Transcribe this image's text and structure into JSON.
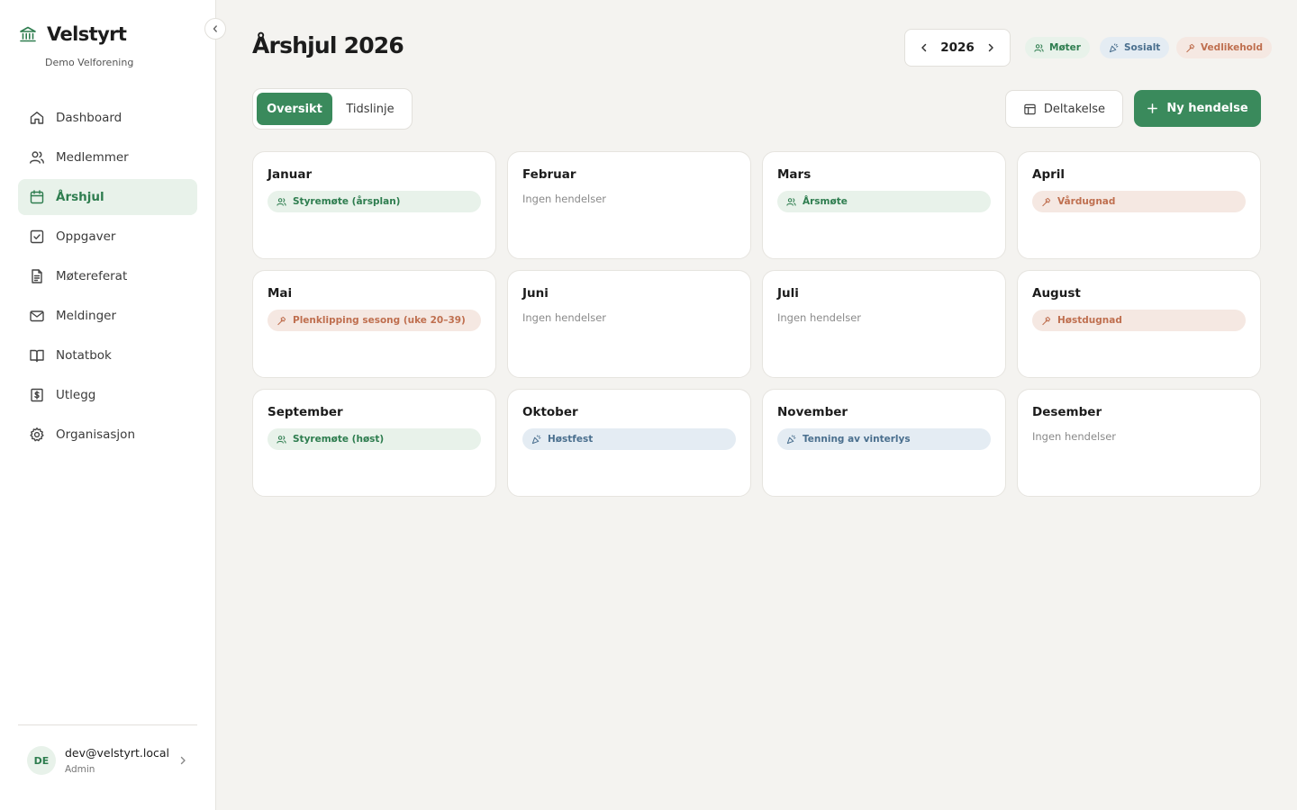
{
  "brand": {
    "name": "Velstyrt",
    "org": "Demo Velforening"
  },
  "nav": [
    {
      "label": "Dashboard",
      "icon": "home-icon",
      "active": false
    },
    {
      "label": "Medlemmer",
      "icon": "users-icon",
      "active": false
    },
    {
      "label": "Årshjul",
      "icon": "calendar-icon",
      "active": true
    },
    {
      "label": "Oppgaver",
      "icon": "checkbox-icon",
      "active": false
    },
    {
      "label": "Møtereferat",
      "icon": "document-icon",
      "active": false
    },
    {
      "label": "Meldinger",
      "icon": "mail-icon",
      "active": false
    },
    {
      "label": "Notatbok",
      "icon": "book-icon",
      "active": false
    },
    {
      "label": "Utlegg",
      "icon": "receipt-dollar-icon",
      "active": false
    },
    {
      "label": "Organisasjon",
      "icon": "gear-icon",
      "active": false
    }
  ],
  "user": {
    "initials": "DE",
    "email": "dev@velstyrt.local",
    "role": "Admin"
  },
  "header": {
    "title": "Årshjul 2026",
    "year": "2026",
    "legend": {
      "moter": "Møter",
      "sosialt": "Sosialt",
      "vedlikehold": "Vedlikehold"
    }
  },
  "view_toggle": {
    "overview": "Oversikt",
    "timeline": "Tidslinje",
    "selected": "overview"
  },
  "actions": {
    "participation": "Deltakelse",
    "new_event": "Ny hendelse"
  },
  "empty_label": "Ingen hendelser",
  "colors": {
    "accent": "#3a8a5c",
    "moter_bg": "#e8f2ea",
    "moter_fg": "#2e7d4f",
    "sosialt_bg": "#e4ecf3",
    "sosialt_fg": "#4a6f8e",
    "vedlikehold_bg": "#f5e8e2",
    "vedlikehold_fg": "#bf6f4f"
  },
  "months": [
    {
      "name": "Januar",
      "events": [
        {
          "title": "Styremøte (årsplan)",
          "category": "moter"
        }
      ]
    },
    {
      "name": "Februar",
      "events": []
    },
    {
      "name": "Mars",
      "events": [
        {
          "title": "Årsmøte",
          "category": "moter"
        }
      ]
    },
    {
      "name": "April",
      "events": [
        {
          "title": "Vårdugnad",
          "category": "vedlikehold"
        }
      ]
    },
    {
      "name": "Mai",
      "events": [
        {
          "title": "Plenklipping sesong (uke 20–39)",
          "category": "vedlikehold"
        }
      ]
    },
    {
      "name": "Juni",
      "events": []
    },
    {
      "name": "Juli",
      "events": []
    },
    {
      "name": "August",
      "events": [
        {
          "title": "Høstdugnad",
          "category": "vedlikehold"
        }
      ]
    },
    {
      "name": "September",
      "events": [
        {
          "title": "Styremøte (høst)",
          "category": "moter"
        }
      ]
    },
    {
      "name": "Oktober",
      "events": [
        {
          "title": "Høstfest",
          "category": "sosialt"
        }
      ]
    },
    {
      "name": "November",
      "events": [
        {
          "title": "Tenning av vinterlys",
          "category": "sosialt"
        }
      ]
    },
    {
      "name": "Desember",
      "events": []
    }
  ]
}
